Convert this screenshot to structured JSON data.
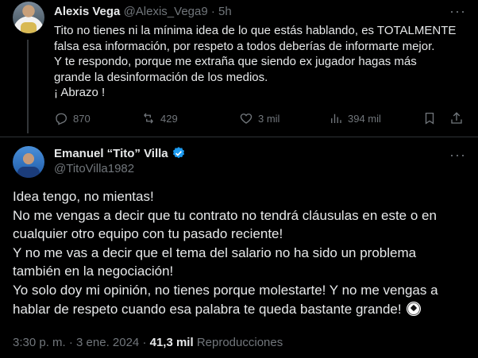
{
  "reply_tweet": {
    "author_name": "Alexis Vega",
    "handle": "@Alexis_Vega9",
    "separator": "·",
    "time": "5h",
    "lines": [
      "Tito no tienes ni la mínima idea de lo que estás hablando, es TOTALMENTE",
      "falsa esa información, por respeto a todos deberías de informarte mejor.",
      "Y te respondo, porque me extraña que siendo ex jugador hagas más",
      "grande la desinformación de los medios.",
      "¡ Abrazo !"
    ],
    "replies": "870",
    "retweets": "429",
    "likes": "3 mil",
    "views": "394 mil"
  },
  "main_tweet": {
    "author_name": "Emanuel “Tito” Villa",
    "handle": "@TitoVilla1982",
    "verified_color": "#1d9bf0",
    "lines": [
      "Idea tengo, no mientas!",
      "No me vengas a decir que tu contrato no tendrá cláusulas en este o en",
      "cualquier otro equipo con tu pasado reciente!",
      "Y no me vas a decir que el tema del salario no ha sido un problema",
      "también en la negociación!",
      "Yo solo doy mi opinión, no tienes porque molestarte! Y no me vengas a",
      "hablar de respeto cuando esa palabra te queda bastante grande!"
    ],
    "timestamp": "3:30 p. m. · 3 ene. 2024 ·",
    "view_count": "41,3 mil",
    "views_label": "Reproducciones"
  },
  "icons": [
    "reply-icon",
    "retweet-icon",
    "like-icon",
    "views-icon",
    "bookmark-icon",
    "share-icon",
    "more-icon",
    "verified-badge-icon",
    "soccer-ball-icon"
  ]
}
